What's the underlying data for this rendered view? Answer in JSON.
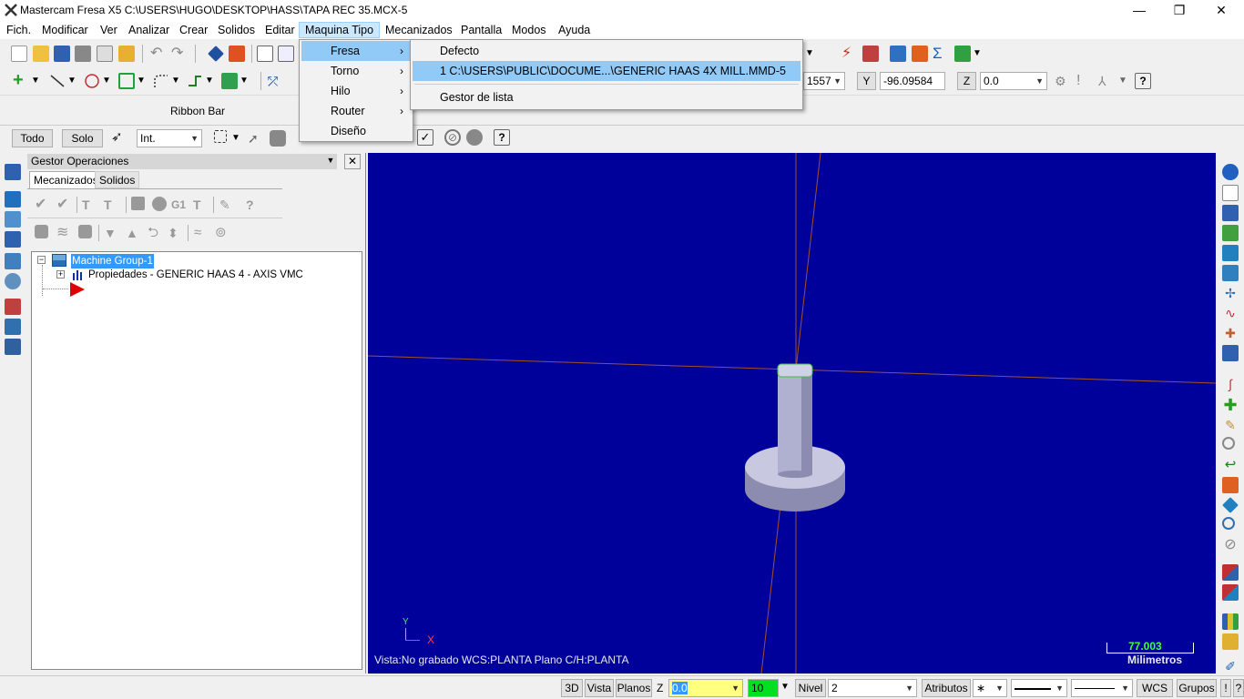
{
  "window": {
    "title": "Mastercam Fresa X5  C:\\USERS\\HUGO\\DESKTOP\\HASS\\TAPA REC 35.MCX-5",
    "controls": [
      "—",
      "❐",
      "✕"
    ]
  },
  "menubar": [
    "Fich.",
    "Modificar",
    "Ver",
    "Analizar",
    "Crear",
    "Solidos",
    "Editar",
    "Maquina Tipo",
    "Mecanizados",
    "Pantalla",
    "Modos",
    "Ayuda"
  ],
  "maquina_menu": {
    "items": [
      "Fresa",
      "Torno",
      "Hilo",
      "Router",
      "Diseño"
    ]
  },
  "fresa_submenu": {
    "items": [
      "Defecto",
      "1  C:\\USERS\\PUBLIC\\DOCUME...\\GENERIC HAAS 4X MILL.MMD-5",
      "Gestor de lista"
    ]
  },
  "coords": {
    "x_value": "1557",
    "y_label": "Y",
    "y_value": "-96.09584",
    "z_label": "Z",
    "z_value": "0.0"
  },
  "ribbon": {
    "label": "Ribbon Bar"
  },
  "selection_bar": {
    "todo": "Todo",
    "solo": "Solo",
    "mode": "Int."
  },
  "ops_panel": {
    "title": "Gestor Operaciones",
    "tabs": [
      "Mecanizados",
      "Solidos"
    ],
    "tree": {
      "group": "Machine Group-1",
      "props": "Propiedades - GENERIC HAAS 4 - AXIS VMC"
    }
  },
  "viewport": {
    "status": "Vista:No grabado   WCS:PLANTA   Plano C/H:PLANTA",
    "scale_value": "77.003",
    "scale_unit": "Milimetros",
    "axis_y": "Y",
    "axis_x": "X"
  },
  "statusbar": {
    "b3d": "3D",
    "vista": "Vista",
    "planos": "Planos",
    "z_label": "Z",
    "z_value": "0.0",
    "color": "10",
    "nivel_label": "Nivel",
    "nivel_value": "2",
    "atributos": "Atributos",
    "wcs": "WCS",
    "grupos": "Grupos",
    "excl": "!",
    "help": "?"
  },
  "colors": {
    "viewport_bg": "#00009b",
    "menu_highlight": "#91c9f7",
    "selected_node": "#3399ff",
    "axis_line": "#a0522d"
  }
}
